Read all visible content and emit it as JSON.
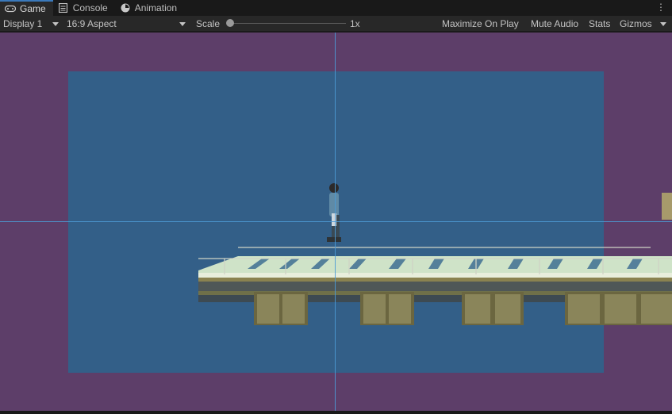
{
  "tabs": [
    {
      "label": "Game",
      "icon": "gamepad-icon",
      "active": true
    },
    {
      "label": "Console",
      "icon": "console-icon",
      "active": false
    },
    {
      "label": "Animation",
      "icon": "animation-icon",
      "active": false
    }
  ],
  "toolbar": {
    "display": "Display 1",
    "aspect": "16:9 Aspect",
    "scale_label": "Scale",
    "scale_value": "1x",
    "maximize": "Maximize On Play",
    "mute": "Mute Audio",
    "stats": "Stats",
    "gizmos": "Gizmos"
  },
  "colors": {
    "background": "#5d3e69",
    "game_view": "#335f88",
    "crosshair": "#4c9ad4",
    "tab_accent": "#3a79bb"
  }
}
